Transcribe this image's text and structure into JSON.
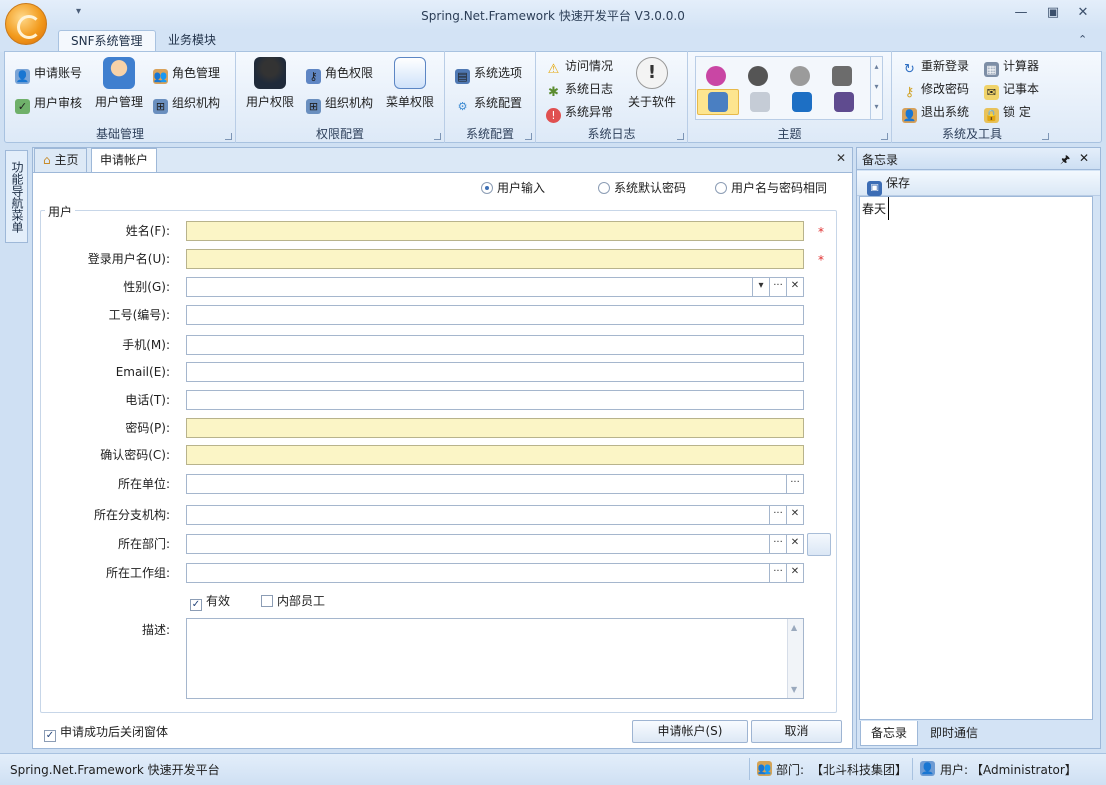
{
  "window": {
    "title": "Spring.Net.Framework 快速开发平台 V3.0.0.0",
    "qat_glyph": "▾",
    "controls": {
      "minimize": "—",
      "restore": "▣",
      "close": "✕"
    }
  },
  "ribbon": {
    "tabs": [
      {
        "label": "SNF系统管理",
        "active": true
      },
      {
        "label": "业务模块",
        "active": false
      }
    ],
    "collapse_glyph": "⌃",
    "groups": {
      "basic": {
        "label": "基础管理",
        "items": {
          "apply_account": "申请账号",
          "user_audit": "用户审核",
          "user_manage": "用户管理",
          "role_manage": "角色管理",
          "org": "组织机构"
        }
      },
      "perm": {
        "label": "权限配置",
        "items": {
          "user_perm": "用户权限",
          "role_perm": "角色权限",
          "org_perm": "组织机构",
          "menu_perm": "菜单权限"
        }
      },
      "syscfg": {
        "label": "系统配置",
        "items": {
          "options": "系统选项",
          "config": "系统配置"
        }
      },
      "log": {
        "label": "系统日志",
        "items": {
          "visits": "访问情况",
          "syslog": "系统日志",
          "exceptions": "系统异常",
          "about": "关于软件"
        }
      },
      "theme": {
        "label": "主题",
        "icons": [
          "office-2010-icon",
          "office-2013-icon",
          "office-2007-icon",
          "metro-grid-icon",
          "flat-tiles-icon",
          "gray-tiles-icon",
          "office-logo-icon",
          "visualstudio-icon"
        ]
      },
      "tools": {
        "label": "系统及工具",
        "items": {
          "relogin": "重新登录",
          "calculator": "计算器",
          "change_pwd": "修改密码",
          "notepad": "记事本",
          "exit": "退出系统",
          "lock": "锁  定"
        }
      }
    }
  },
  "left_nav": {
    "label": "功能导航菜单"
  },
  "doc_tabs": [
    {
      "label": "主页",
      "active": false
    },
    {
      "label": "申请帐户",
      "active": true
    }
  ],
  "form": {
    "password_mode": {
      "options": [
        "用户输入",
        "系统默认密码",
        "用户名与密码相同"
      ],
      "selected": "用户输入"
    },
    "group_title": "用户",
    "fields": {
      "name": {
        "label": "姓名(F):",
        "value": "",
        "required": true
      },
      "login": {
        "label": "登录用户名(U):",
        "value": "",
        "required": true
      },
      "gender": {
        "label": "性别(G):",
        "value": ""
      },
      "employee_no": {
        "label": "工号(编号):",
        "value": ""
      },
      "mobile": {
        "label": "手机(M):",
        "value": ""
      },
      "email": {
        "label": "Email(E):",
        "value": ""
      },
      "phone": {
        "label": "电话(T):",
        "value": ""
      },
      "password": {
        "label": "密码(P):",
        "value": ""
      },
      "confirm": {
        "label": "确认密码(C):",
        "value": ""
      },
      "company": {
        "label": "所在单位:",
        "value": ""
      },
      "branch": {
        "label": "所在分支机构:",
        "value": ""
      },
      "department": {
        "label": "所在部门:",
        "value": ""
      },
      "workgroup": {
        "label": "所在工作组:",
        "value": ""
      },
      "description": {
        "label": "描述:",
        "value": ""
      }
    },
    "required_mark": "*",
    "btn_glyphs": {
      "dropdown": "▾",
      "ellipsis": "···",
      "clear": "✕"
    },
    "checks": {
      "enabled": {
        "label": "有效",
        "checked": true
      },
      "internal": {
        "label": "内部员工",
        "checked": false
      },
      "close_after": {
        "label": "申请成功后关闭窗体",
        "checked": true
      }
    },
    "buttons": {
      "apply": "申请帐户(S)",
      "cancel": "取消"
    }
  },
  "memo_panel": {
    "title": "备忘录",
    "save_label": "保存",
    "content": "春天",
    "tabs": [
      "备忘录",
      "即时通信"
    ],
    "pin_glyph": "🖈",
    "close_glyph": "✕"
  },
  "status_bar": {
    "app_name": "Spring.Net.Framework 快速开发平台",
    "dept_label": "部门:",
    "dept_value": "【北斗科技集团】",
    "user_label": "用户:",
    "user_value": "【Administrator】"
  }
}
